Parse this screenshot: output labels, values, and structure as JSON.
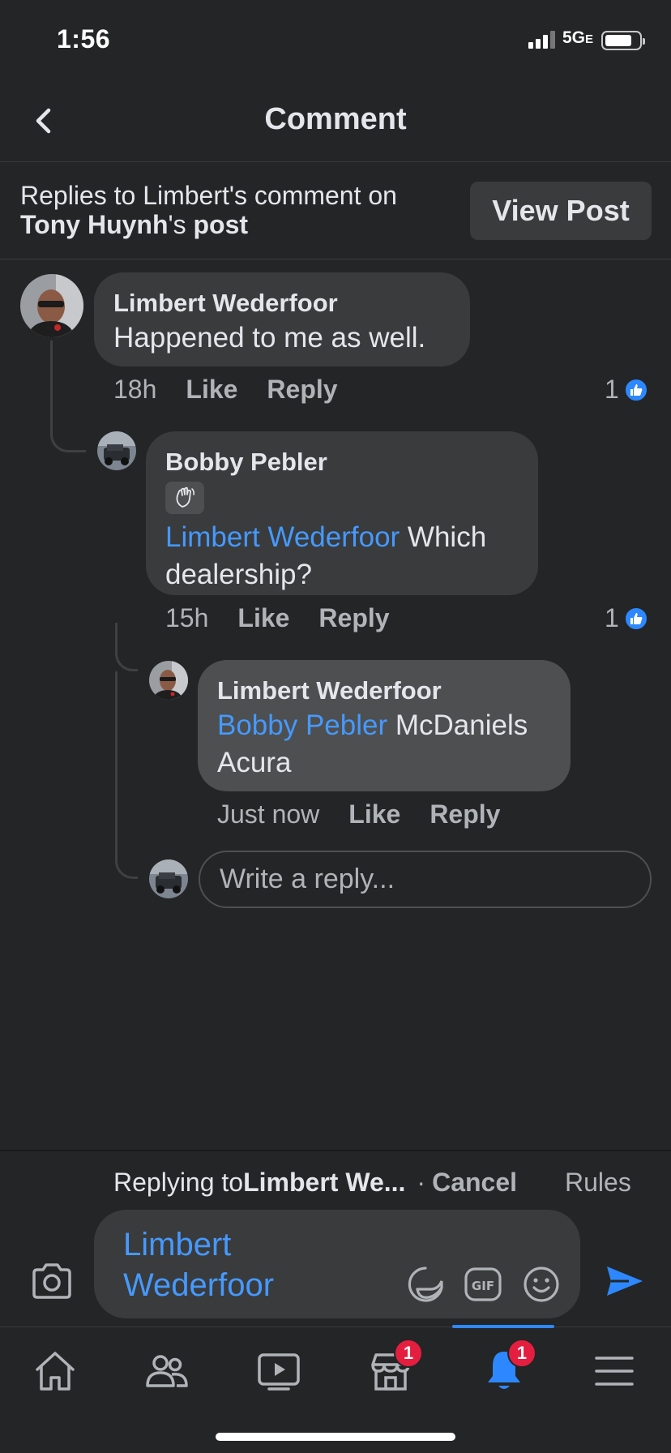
{
  "status_bar": {
    "time": "1:56",
    "network": "5G",
    "network_suffix": "E"
  },
  "header": {
    "title": "Comment"
  },
  "context": {
    "prefix": "Replies to Limbert's comment on",
    "post_author": "Tony Huynh",
    "suffix_possessive": "'s ",
    "post_word": "post",
    "view_post_label": "View Post"
  },
  "comments": [
    {
      "author": "Limbert Wederfoor",
      "text": "Happened to me as well.",
      "time": "18h",
      "like_label": "Like",
      "reply_label": "Reply",
      "like_count": "1"
    },
    {
      "author": "Bobby Pebler",
      "mention": "Limbert Wederfoor",
      "text": " Which dealership?",
      "time": "15h",
      "like_label": "Like",
      "reply_label": "Reply",
      "like_count": "1"
    },
    {
      "author": "Limbert Wederfoor",
      "mention": "Bobby Pebler",
      "text": " McDaniels Acura",
      "time": "Just now",
      "like_label": "Like",
      "reply_label": "Reply"
    }
  ],
  "reply_input": {
    "placeholder": "Write a reply..."
  },
  "composer": {
    "replying_prefix": "Replying to ",
    "replying_name": "Limbert We...",
    "cancel_label": "Cancel",
    "rules_label": "Rules",
    "text": "Limbert Wederfoor"
  },
  "bottom_nav": {
    "items": [
      "home-icon",
      "friends-icon",
      "watch-icon",
      "marketplace-icon",
      "notifications-icon",
      "menu-icon"
    ],
    "marketplace_badge": "1",
    "notifications_badge": "1"
  },
  "colors": {
    "background": "#242526",
    "bubble": "#3a3b3c",
    "mention": "#4599ff",
    "accent": "#2d88ff",
    "badge": "#e41e3f"
  }
}
